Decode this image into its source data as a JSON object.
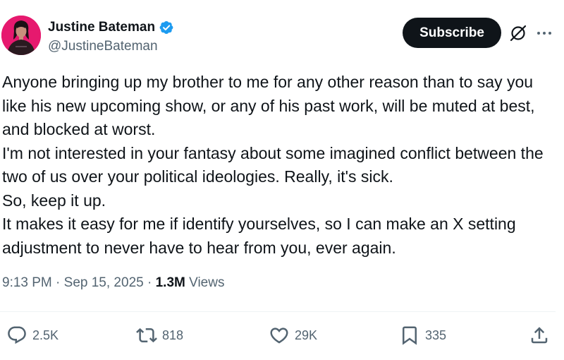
{
  "author": {
    "display_name": "Justine Bateman",
    "handle": "@JustineBateman",
    "avatar_icon": "profile-photo",
    "verified_icon": "verified-badge-icon",
    "verified_color": "#1d9bf0"
  },
  "header": {
    "subscribe_label": "Subscribe",
    "grok_icon": "grok-icon",
    "more_icon": "more-dots-icon"
  },
  "tweet": {
    "lines": [
      "Anyone bringing up my brother to me for any other reason than to say you like his new upcoming show, or any of his past work, will be muted at best, and blocked at worst.",
      "I'm not interested in your fantasy about some imagined conflict between the two of us over your political ideologies. Really, it's sick.",
      "So, keep it up.",
      "It makes it easy for me if identify yourselves, so I can make an X setting adjustment to never have to hear from you, ever again."
    ]
  },
  "meta": {
    "time": "9:13 PM",
    "separator": "·",
    "date": "Sep 15, 2025",
    "views_count": "1.3M",
    "views_label": "Views"
  },
  "actions": {
    "replies": "2.5K",
    "reposts": "818",
    "likes": "29K",
    "bookmarks": "335"
  },
  "colors": {
    "text": "#0f1419",
    "secondary": "#536471",
    "button_bg": "#0f1419",
    "avatar_bg": "#e6196e"
  }
}
